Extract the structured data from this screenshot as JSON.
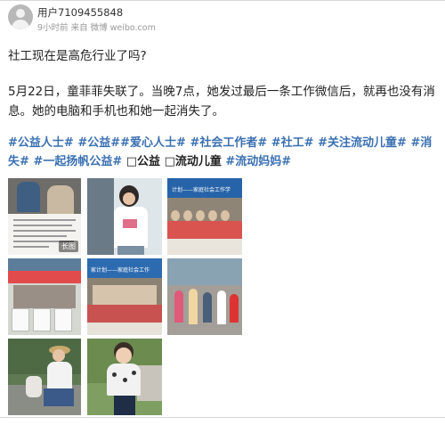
{
  "user": {
    "name": "用户7109455848",
    "meta": "9小时前 来自 微博 weibo.com"
  },
  "post": {
    "title": "社工现在是高危行业了吗?",
    "body": "5月22日，童菲菲失联了。当晚7点，她发过最后一条工作微信后，就再也没有消息。她的电脑和手机也和她一起消失了。"
  },
  "tags": [
    {
      "text": "#公益人士#",
      "type": "tag"
    },
    {
      "text": " ",
      "type": "plain"
    },
    {
      "text": "#公益#",
      "type": "tag"
    },
    {
      "text": "#爱心人士#",
      "type": "tag"
    },
    {
      "text": " ",
      "type": "plain"
    },
    {
      "text": "#社会工作者#",
      "type": "tag"
    },
    {
      "text": " ",
      "type": "plain"
    },
    {
      "text": "#社工#",
      "type": "tag"
    },
    {
      "text": " ",
      "type": "plain"
    },
    {
      "text": "#关注流动儿童#",
      "type": "tag"
    },
    {
      "text": " ",
      "type": "plain"
    },
    {
      "text": "#消失#",
      "type": "tag"
    },
    {
      "text": " ",
      "type": "plain"
    },
    {
      "text": "#一起扬帆公益#",
      "type": "tag"
    },
    {
      "text": " □公益 □流动儿童 ",
      "type": "plain"
    },
    {
      "text": "#流动妈妈#",
      "type": "tag"
    }
  ],
  "photos": {
    "long_badge": "长图",
    "banner_1": "计划——家庭社会工作学",
    "banner_2": "家计划——家庭社会工作"
  },
  "colors": {
    "link": "#3a70b2",
    "text": "#222222",
    "meta": "#999999"
  }
}
